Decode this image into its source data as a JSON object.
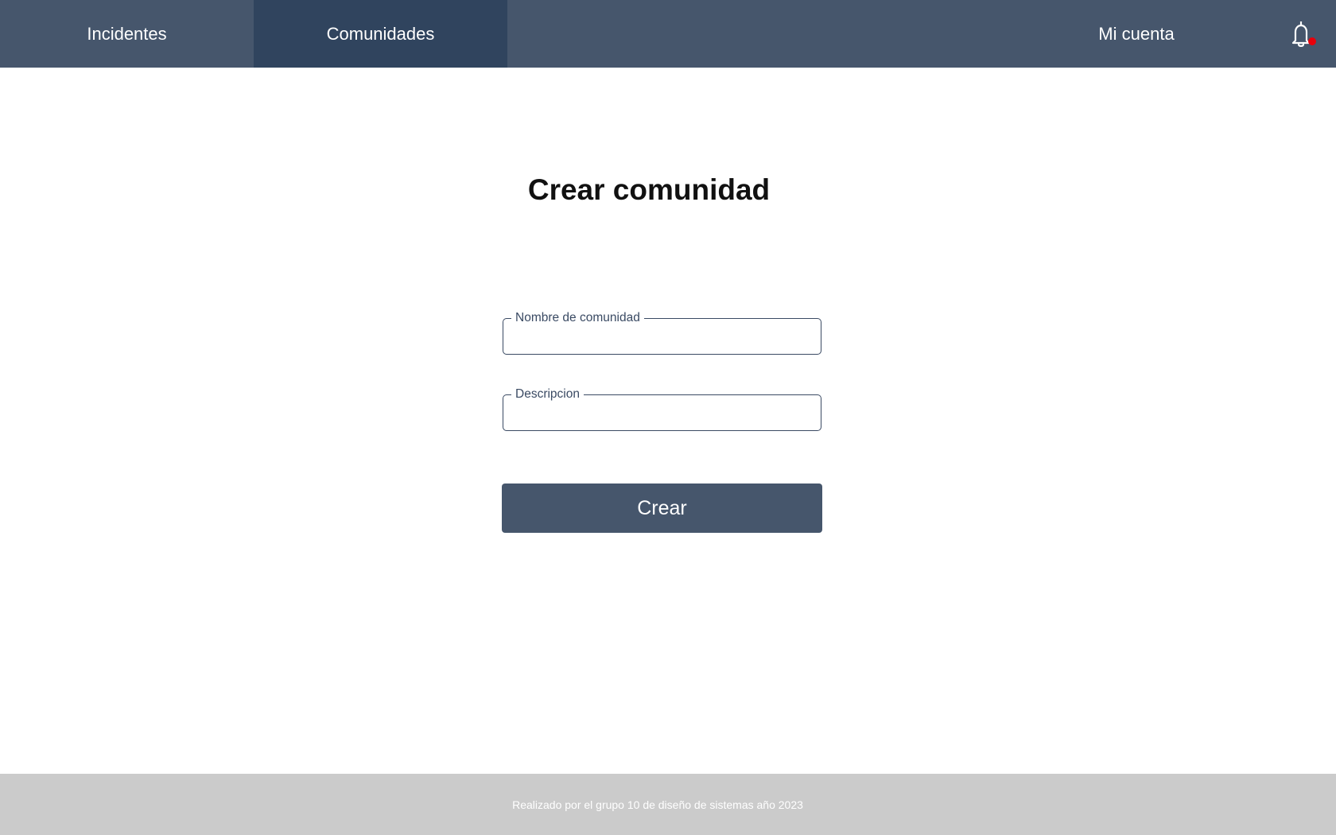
{
  "nav": {
    "tabs": [
      {
        "label": "Incidentes"
      },
      {
        "label": "Comunidades",
        "active": true
      }
    ],
    "account_label": "Mi cuenta",
    "notifications_icon": "bell-icon",
    "notification_badge_color": "#e8000b"
  },
  "main": {
    "title": "Crear comunidad",
    "fields": [
      {
        "label": "Nombre de comunidad",
        "value": ""
      },
      {
        "label": "Descripcion",
        "value": ""
      }
    ],
    "submit_label": "Crear"
  },
  "footer": {
    "text": "Realizado por el grupo 10 de diseño de sistemas año 2023"
  },
  "colors": {
    "nav_bg": "#46566c",
    "nav_active_bg": "#30445e",
    "button_bg": "#46566c",
    "footer_bg": "#cbcbcb"
  }
}
